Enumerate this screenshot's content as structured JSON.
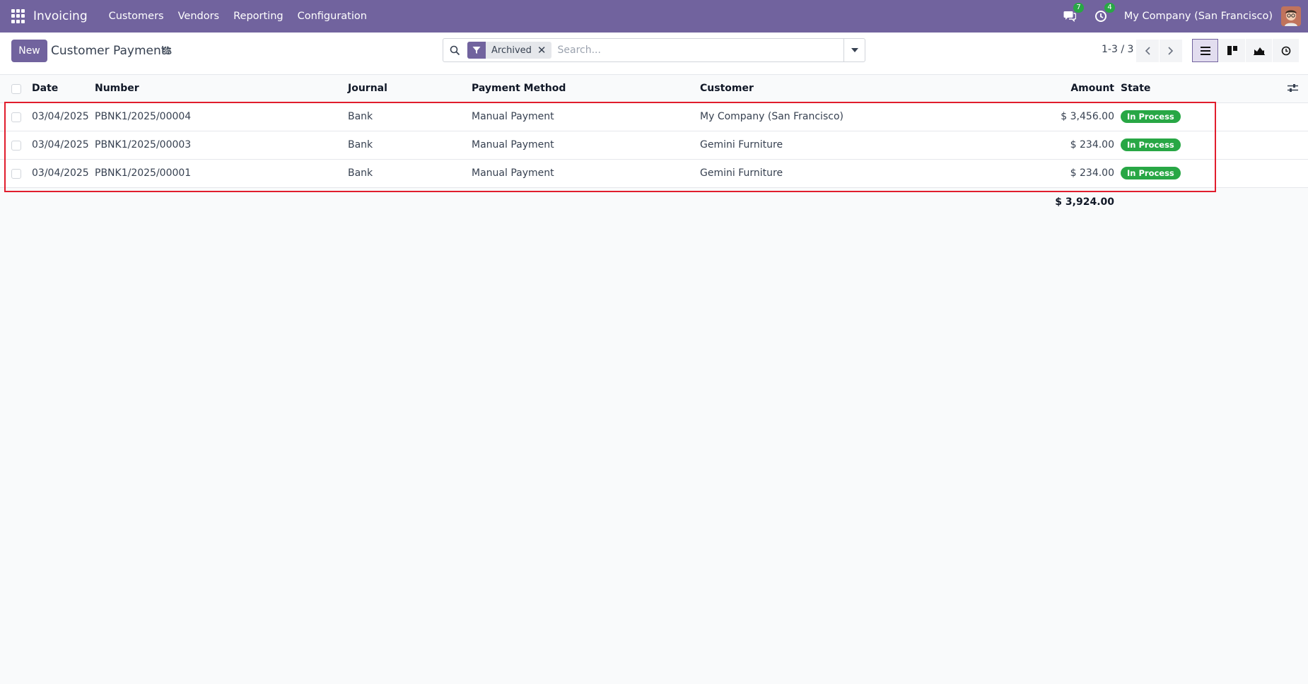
{
  "navbar": {
    "app_name": "Invoicing",
    "menu": [
      "Customers",
      "Vendors",
      "Reporting",
      "Configuration"
    ],
    "messages_count": "7",
    "activities_count": "4",
    "company": "My Company (San Francisco)"
  },
  "control": {
    "new_label": "New",
    "title": "Customer Payments",
    "facet_label": "Archived",
    "search_placeholder": "Search...",
    "pager": "1-3 / 3"
  },
  "table": {
    "headers": {
      "date": "Date",
      "number": "Number",
      "journal": "Journal",
      "payment_method": "Payment Method",
      "customer": "Customer",
      "amount": "Amount",
      "state": "State"
    },
    "rows": [
      {
        "date": "03/04/2025",
        "number": "PBNK1/2025/00004",
        "journal": "Bank",
        "payment_method": "Manual Payment",
        "customer": "My Company (San Francisco)",
        "amount": "$ 3,456.00",
        "state": "In Process"
      },
      {
        "date": "03/04/2025",
        "number": "PBNK1/2025/00003",
        "journal": "Bank",
        "payment_method": "Manual Payment",
        "customer": "Gemini Furniture",
        "amount": "$ 234.00",
        "state": "In Process"
      },
      {
        "date": "03/04/2025",
        "number": "PBNK1/2025/00001",
        "journal": "Bank",
        "payment_method": "Manual Payment",
        "customer": "Gemini Furniture",
        "amount": "$ 234.00",
        "state": "In Process"
      }
    ],
    "total": "$ 3,924.00"
  },
  "colors": {
    "brand": "#71639e",
    "badge_green": "#28a745",
    "highlight_red": "#e11d2d"
  }
}
